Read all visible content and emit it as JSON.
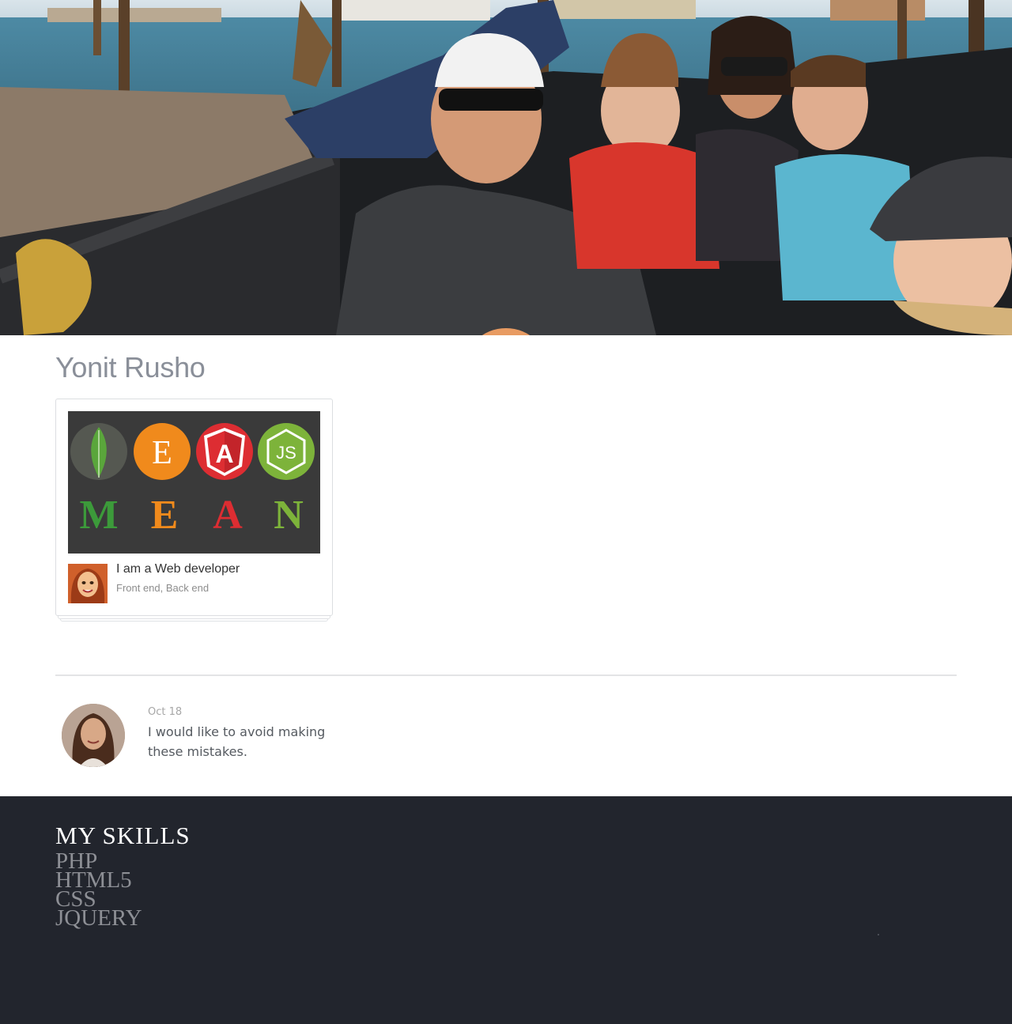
{
  "profile": {
    "name": "Yonit Rusho"
  },
  "card": {
    "image_icons": [
      "mongodb-leaf-icon",
      "express-e-icon",
      "angular-shield-icon",
      "nodejs-hexagon-icon"
    ],
    "image_letters": [
      "M",
      "E",
      "A",
      "N"
    ],
    "image_letter_colors": [
      "#3c9a3a",
      "#f08a1c",
      "#dd2d32",
      "#7db33a"
    ],
    "title": "I am a Web developer",
    "subtitle": "Front end, Back end"
  },
  "comment": {
    "date": "Oct 18",
    "text": "I would like to avoid making these mistakes."
  },
  "skills": {
    "title": "MY SKILLS",
    "items": [
      "PHP",
      "HTML5",
      "CSS",
      "JQUERY"
    ]
  },
  "colors": {
    "footer_bg": "#22252d",
    "name_text": "#8a8f99",
    "divider": "#e3e4e6"
  }
}
